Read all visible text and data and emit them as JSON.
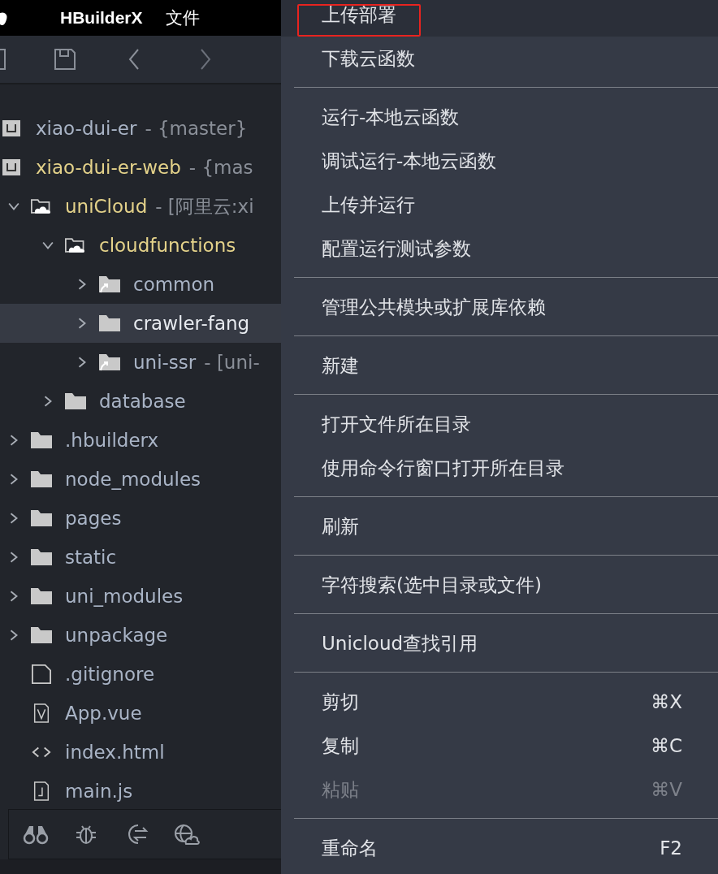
{
  "menu_bar": {
    "app_name": "HBuilderX",
    "items": [
      "文件"
    ]
  },
  "tree": [
    {
      "kind": "project",
      "name": "xiao-dui-er",
      "suffix": "- {master}",
      "active": false,
      "selected": false
    },
    {
      "kind": "project",
      "name": "xiao-dui-er-web",
      "suffix": "- {mas",
      "active": true,
      "selected": false
    },
    {
      "kind": "cloud-folder",
      "name": "uniCloud",
      "suffix": "- [阿里云:xi",
      "active": true,
      "selected": false,
      "expanded": true,
      "children": [
        {
          "kind": "cloud-folder",
          "name": "cloudfunctions",
          "active": true,
          "selected": false,
          "expanded": true,
          "children": [
            {
              "kind": "link-folder",
              "name": "common",
              "active": false,
              "selected": false,
              "expanded": false
            },
            {
              "kind": "folder",
              "name": "crawler-fang",
              "active": false,
              "selected": true,
              "expanded": false
            },
            {
              "kind": "link-folder",
              "name": "uni-ssr",
              "suffix": "- [uni-",
              "active": false,
              "selected": false,
              "expanded": false
            }
          ]
        },
        {
          "kind": "folder",
          "name": "database",
          "active": false,
          "selected": false,
          "expanded": false
        }
      ]
    },
    {
      "kind": "folder",
      "name": ".hbuilderx",
      "active": false,
      "selected": false,
      "expanded": false
    },
    {
      "kind": "folder",
      "name": "node_modules",
      "active": false,
      "selected": false,
      "expanded": false
    },
    {
      "kind": "folder",
      "name": "pages",
      "active": false,
      "selected": false,
      "expanded": false
    },
    {
      "kind": "folder",
      "name": "static",
      "active": false,
      "selected": false,
      "expanded": false
    },
    {
      "kind": "folder",
      "name": "uni_modules",
      "active": false,
      "selected": false,
      "expanded": false
    },
    {
      "kind": "folder",
      "name": "unpackage",
      "active": false,
      "selected": false,
      "expanded": false
    },
    {
      "kind": "file",
      "name": ".gitignore",
      "active": false,
      "selected": false
    },
    {
      "kind": "vue",
      "name": "App.vue",
      "active": false,
      "selected": false
    },
    {
      "kind": "html",
      "name": "index.html",
      "active": false,
      "selected": false
    },
    {
      "kind": "js",
      "name": "main.js",
      "active": false,
      "selected": false
    }
  ],
  "context_menu": [
    [
      {
        "label": "上传部署",
        "selected": true,
        "annotated": true,
        "disabled": false
      },
      {
        "label": "下载云函数",
        "selected": false,
        "annotated": false,
        "disabled": false
      }
    ],
    [
      {
        "label": "运行-本地云函数",
        "selected": false,
        "annotated": false,
        "disabled": false
      },
      {
        "label": "调试运行-本地云函数",
        "selected": false,
        "annotated": false,
        "disabled": false
      },
      {
        "label": "上传并运行",
        "selected": false,
        "annotated": false,
        "disabled": false
      },
      {
        "label": "配置运行测试参数",
        "selected": false,
        "annotated": false,
        "disabled": false
      }
    ],
    [
      {
        "label": "管理公共模块或扩展库依赖",
        "selected": false,
        "annotated": false,
        "disabled": false
      }
    ],
    [
      {
        "label": "新建",
        "selected": false,
        "annotated": false,
        "disabled": false
      }
    ],
    [
      {
        "label": "打开文件所在目录",
        "selected": false,
        "annotated": false,
        "disabled": false
      },
      {
        "label": "使用命令行窗口打开所在目录",
        "selected": false,
        "annotated": false,
        "disabled": false
      }
    ],
    [
      {
        "label": "刷新",
        "selected": false,
        "annotated": false,
        "disabled": false
      }
    ],
    [
      {
        "label": "字符搜索(选中目录或文件)",
        "selected": false,
        "annotated": false,
        "disabled": false
      }
    ],
    [
      {
        "label": "Unicloud查找引用",
        "selected": false,
        "annotated": false,
        "disabled": false
      }
    ],
    [
      {
        "label": "剪切",
        "shortcut": "⌘X",
        "selected": false,
        "annotated": false,
        "disabled": false
      },
      {
        "label": "复制",
        "shortcut": "⌘C",
        "selected": false,
        "annotated": false,
        "disabled": false
      },
      {
        "label": "粘贴",
        "shortcut": "⌘V",
        "selected": false,
        "annotated": false,
        "disabled": true
      }
    ],
    [
      {
        "label": "重命名",
        "shortcut": "F2",
        "selected": false,
        "annotated": false,
        "disabled": false
      }
    ]
  ]
}
